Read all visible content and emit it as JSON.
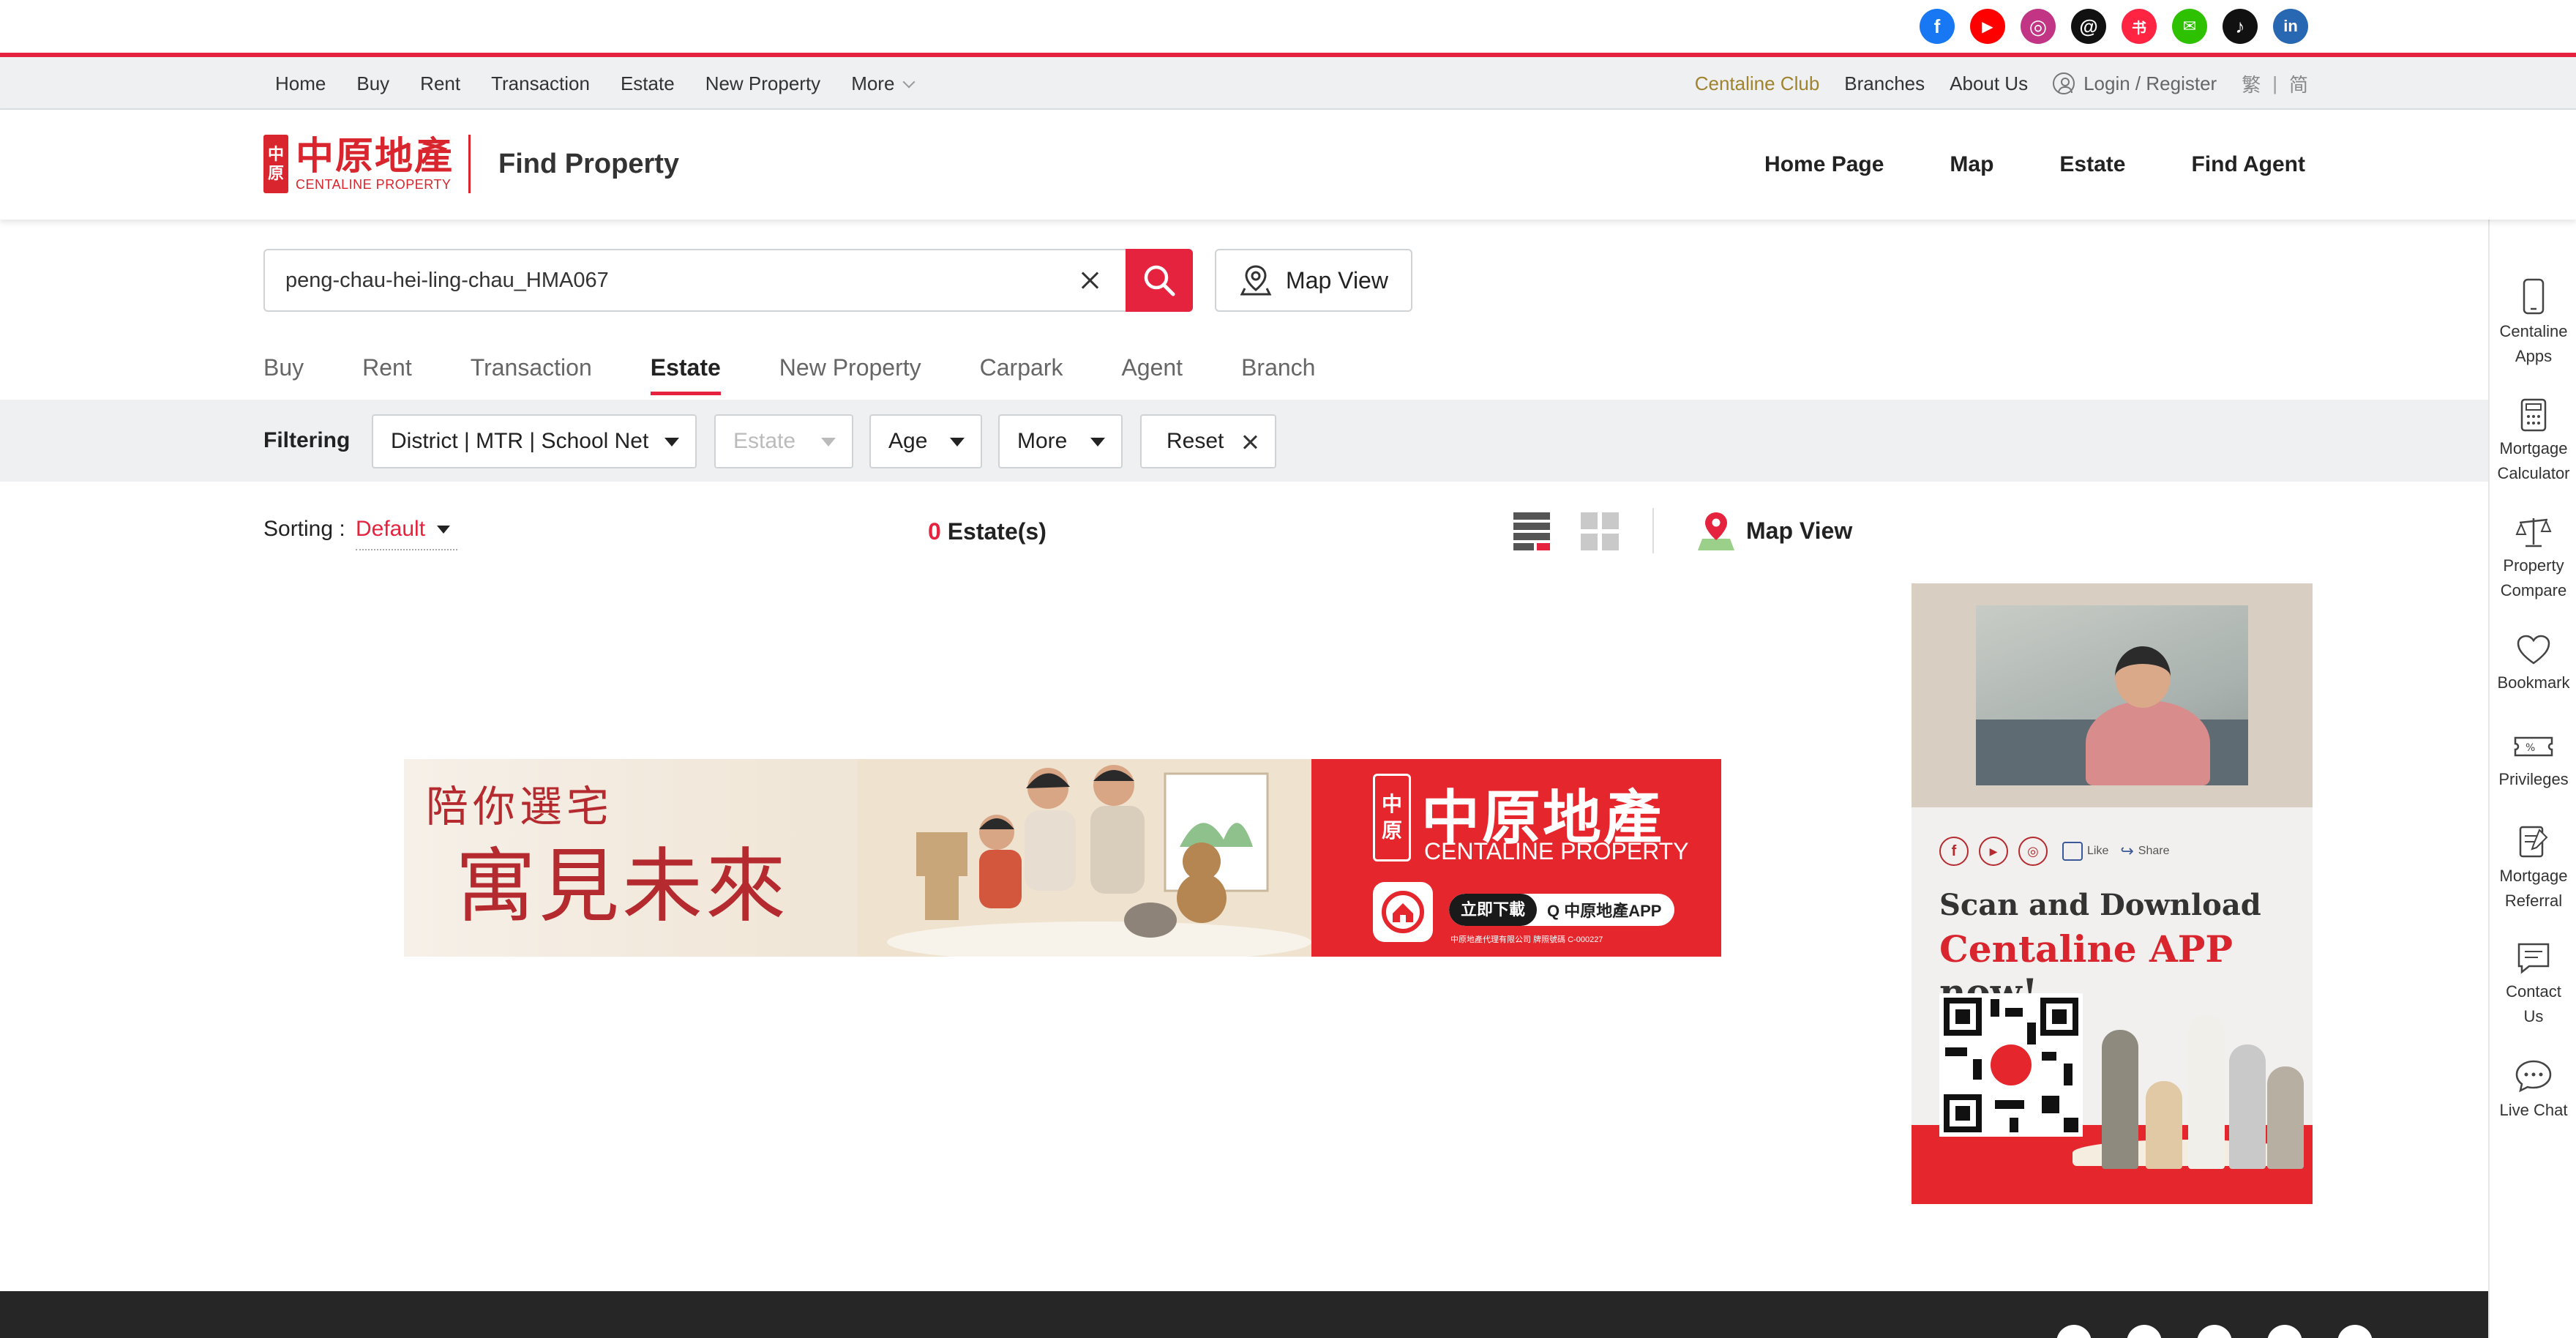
{
  "social_icons": [
    {
      "name": "facebook-icon",
      "color": "#1877f2",
      "glyph": "f"
    },
    {
      "name": "youtube-icon",
      "color": "#ff0000",
      "glyph": "▶"
    },
    {
      "name": "instagram-icon",
      "color": "#c13584",
      "glyph": "◎"
    },
    {
      "name": "threads-icon",
      "color": "#111111",
      "glyph": "@"
    },
    {
      "name": "xiaohongshu-icon",
      "color": "#ff2442",
      "glyph": "书"
    },
    {
      "name": "wechat-icon",
      "color": "#2dc100",
      "glyph": "✉"
    },
    {
      "name": "tiktok-icon",
      "color": "#111111",
      "glyph": "♪"
    },
    {
      "name": "linkedin-icon",
      "color": "#2867b2",
      "glyph": "in"
    }
  ],
  "topnav": {
    "left": [
      "Home",
      "Buy",
      "Rent",
      "Transaction",
      "Estate",
      "New Property",
      "More"
    ],
    "club": "Centaline Club",
    "branches": "Branches",
    "about": "About Us",
    "login": "Login / Register",
    "lang_trad": "繁",
    "lang_sep": "|",
    "lang_simp": "简"
  },
  "header": {
    "logo_seal_top": "中",
    "logo_seal_bottom": "原",
    "logo_cn": "中原地產",
    "logo_en": "CENTALINE PROPERTY",
    "title": "Find Property",
    "nav": [
      "Home Page",
      "Map",
      "Estate",
      "Find Agent"
    ]
  },
  "search": {
    "value": "peng-chau-hei-ling-chau_HMA067",
    "map_view": "Map View"
  },
  "tabs": [
    "Buy",
    "Rent",
    "Transaction",
    "Estate",
    "New Property",
    "Carpark",
    "Agent",
    "Branch"
  ],
  "active_tab": "Estate",
  "filter": {
    "label": "Filtering",
    "district": "District | MTR | School Net",
    "estate": "Estate",
    "age": "Age",
    "more": "More",
    "reset": "Reset"
  },
  "results": {
    "sort_label": "Sorting :",
    "sort_value": "Default",
    "count": "0",
    "count_label": "Estate(s)",
    "map_view": "Map View"
  },
  "banner": {
    "slogan_line1": "陪你選宅",
    "slogan_line2": "寓見未來",
    "seal_top": "中",
    "seal_bottom": "原",
    "brand_cn": "中原地產",
    "brand_en": "CENTALINE PROPERTY",
    "download": "立即下載",
    "app_name": "Q 中原地產APP",
    "fine_print": "中原地產代理有限公司  牌照號碼 C-000227"
  },
  "app_ad": {
    "like": "Like",
    "share": "Share",
    "line1": "Scan and Download",
    "line2_red": "Centaline APP",
    "line2_rest": " now!"
  },
  "sidebar": [
    {
      "name": "centaline-apps",
      "line1": "Centaline",
      "line2": "Apps"
    },
    {
      "name": "mortgage-calculator",
      "line1": "Mortgage",
      "line2": "Calculator"
    },
    {
      "name": "property-compare",
      "line1": "Property",
      "line2": "Compare"
    },
    {
      "name": "bookmark",
      "line1": "Bookmark",
      "line2": ""
    },
    {
      "name": "privileges",
      "line1": "Privileges",
      "line2": ""
    },
    {
      "name": "mortgage-referral",
      "line1": "Mortgage",
      "line2": "Referral"
    },
    {
      "name": "contact-us",
      "line1": "Contact",
      "line2": "Us"
    },
    {
      "name": "live-chat",
      "line1": "Live Chat",
      "line2": ""
    }
  ],
  "colors": {
    "brand_red": "#e5233e",
    "gold": "#a0832f",
    "footer": "#262626"
  }
}
